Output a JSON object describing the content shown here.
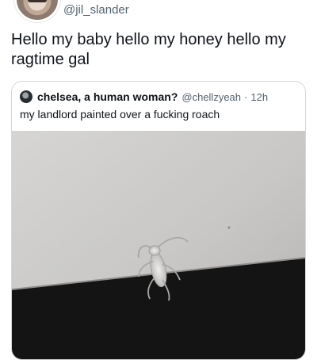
{
  "tweet": {
    "handle": "@jil_slander",
    "text": "Hello my baby hello my honey hello my ragtime gal"
  },
  "quoted": {
    "name": "chelsea, a human woman?",
    "handle": "@chellzyeah",
    "separator": "·",
    "time": "12h",
    "text": "my landlord painted over a fucking roach"
  },
  "colors": {
    "wall": "#c9c8c6",
    "shadow": "#141414",
    "border": "#cfd9de",
    "secondary_text": "#536471"
  },
  "icons": {
    "avatar": "profile-photo",
    "quoted_avatar": "profile-photo"
  }
}
